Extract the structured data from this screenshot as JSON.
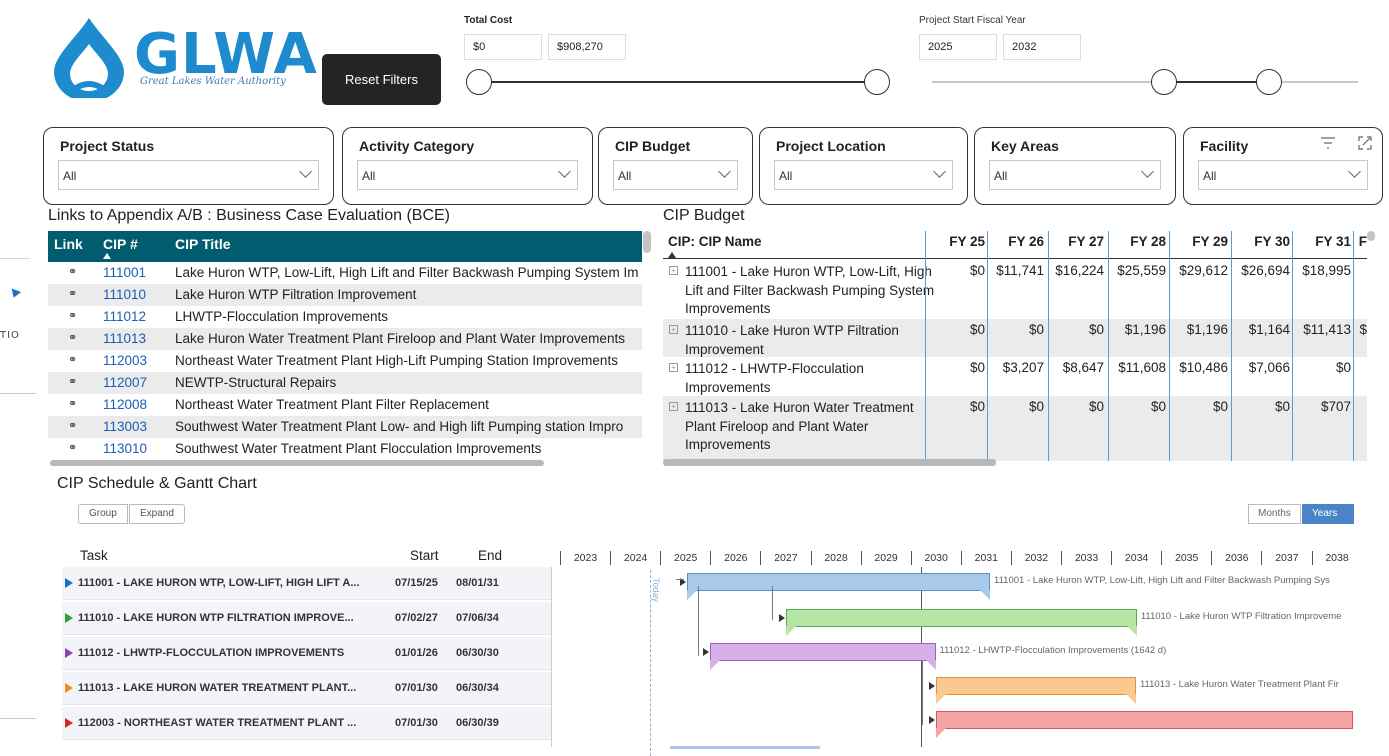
{
  "logo": {
    "name": "GLWA",
    "subtitle": "Great Lakes Water Authority"
  },
  "left_strip": {
    "text": "TIO"
  },
  "reset_button": "Reset Filters",
  "total_cost": {
    "label": "Total Cost",
    "min": "$0",
    "max": "$908,270"
  },
  "start_year": {
    "label": "Project Start Fiscal Year",
    "min": "2025",
    "max": "2032"
  },
  "slicers": [
    {
      "title": "Project Status",
      "value": "All"
    },
    {
      "title": "Activity Category",
      "value": "All"
    },
    {
      "title": "CIP Budget",
      "value": "All"
    },
    {
      "title": "Project Location",
      "value": "All"
    },
    {
      "title": "Key Areas",
      "value": "All"
    },
    {
      "title": "Facility",
      "value": "All"
    }
  ],
  "bce": {
    "title": "Links to Appendix A/B : Business Case Evaluation (BCE)",
    "columns": [
      "Link",
      "CIP #",
      "CIP Title"
    ],
    "link_glyph": "⚭",
    "rows": [
      {
        "cip": "111001",
        "title": "Lake Huron WTP, Low-Lift, High Lift and Filter Backwash Pumping System Im"
      },
      {
        "cip": "111010",
        "title": "Lake Huron WTP Filtration Improvement"
      },
      {
        "cip": "111012",
        "title": "LHWTP-Flocculation Improvements"
      },
      {
        "cip": "111013",
        "title": "Lake Huron Water Treatment Plant Fireloop and Plant Water Improvements"
      },
      {
        "cip": "112003",
        "title": "Northeast Water Treatment Plant High-Lift Pumping Station Improvements"
      },
      {
        "cip": "112007",
        "title": "NEWTP-Structural Repairs"
      },
      {
        "cip": "112008",
        "title": "Northeast Water Treatment Plant Filter Replacement"
      },
      {
        "cip": "113003",
        "title": "Southwest Water Treatment Plant Low- and High lift Pumping station Impro"
      },
      {
        "cip": "113010",
        "title": "Southwest Water Treatment Plant Flocculation Improvements"
      }
    ]
  },
  "budget": {
    "title": "CIP Budget",
    "name_header": "CIP: CIP Name",
    "fy_headers": [
      "FY 25",
      "FY 26",
      "FY 27",
      "FY 28",
      "FY 29",
      "FY 30",
      "FY 31",
      "F"
    ],
    "expand_glyph": "+",
    "rows": [
      {
        "name": "111001 - Lake Huron WTP, Low-Lift, High Lift and Filter Backwash Pumping System Improvements",
        "values": [
          "$0",
          "$11,741",
          "$16,224",
          "$25,559",
          "$29,612",
          "$26,694",
          "$18,995",
          ""
        ]
      },
      {
        "name": "111010 - Lake Huron WTP Filtration Improvement",
        "values": [
          "$0",
          "$0",
          "$0",
          "$1,196",
          "$1,196",
          "$1,164",
          "$11,413",
          "$"
        ]
      },
      {
        "name": "111012 - LHWTP-Flocculation Improvements",
        "values": [
          "$0",
          "$3,207",
          "$8,647",
          "$11,608",
          "$10,486",
          "$7,066",
          "$0",
          ""
        ]
      },
      {
        "name": "111013 - Lake Huron Water Treatment Plant Fireloop and Plant Water Improvements",
        "values": [
          "$0",
          "$0",
          "$0",
          "$0",
          "$0",
          "$0",
          "$707",
          ""
        ]
      }
    ]
  },
  "gantt": {
    "title": "CIP Schedule & Gantt Chart",
    "buttons": [
      "Group",
      "Expand"
    ],
    "view_toggle": [
      "Months",
      "Years"
    ],
    "active_view": "Years",
    "headers": {
      "task": "Task",
      "start": "Start",
      "end": "End"
    },
    "today_label": "Today",
    "years": [
      "2023",
      "2024",
      "2025",
      "2026",
      "2027",
      "2028",
      "2029",
      "2030",
      "2031",
      "2032",
      "2033",
      "2034",
      "2035",
      "2036",
      "2037",
      "2038"
    ],
    "tasks": [
      {
        "name": "111001 - LAKE HURON WTP, LOW-LIFT, HIGH LIFT A...",
        "start": "07/15/25",
        "end": "08/01/31",
        "color": "#1a73c9",
        "bar_color": "#a9c9ea",
        "bar_border": "#5b8fc7",
        "bar_label": "111001 - Lake Huron WTP, Low-Lift, High Lift and Filter Backwash Pumping Sys"
      },
      {
        "name": "111010 - LAKE HURON WTP FILTRATION IMPROVE...",
        "start": "07/02/27",
        "end": "07/06/34",
        "color": "#2e9e3e",
        "bar_color": "#b6e6a6",
        "bar_border": "#5aa85a",
        "bar_label": "111010 - Lake Huron WTP Filtration Improveme"
      },
      {
        "name": "111012 - LHWTP-FLOCCULATION IMPROVEMENTS",
        "start": "01/01/26",
        "end": "06/30/30",
        "color": "#8e44ad",
        "bar_color": "#d6b1e8",
        "bar_border": "#9a62b8",
        "bar_label": "111012 - LHWTP-Flocculation Improvements (1642 d)"
      },
      {
        "name": "111013 - LAKE HURON WATER TREATMENT PLANT...",
        "start": "07/01/30",
        "end": "06/30/34",
        "color": "#f08a1c",
        "bar_color": "#fbc98f",
        "bar_border": "#e0913c",
        "bar_label": "111013 - Lake Huron Water Treatment Plant Fir"
      },
      {
        "name": "112003 - NORTHEAST WATER TREATMENT PLANT ...",
        "start": "07/01/30",
        "end": "06/30/39",
        "color": "#d62626",
        "bar_color": "#f5a3a3",
        "bar_border": "#d45b5b",
        "bar_label": ""
      }
    ]
  }
}
